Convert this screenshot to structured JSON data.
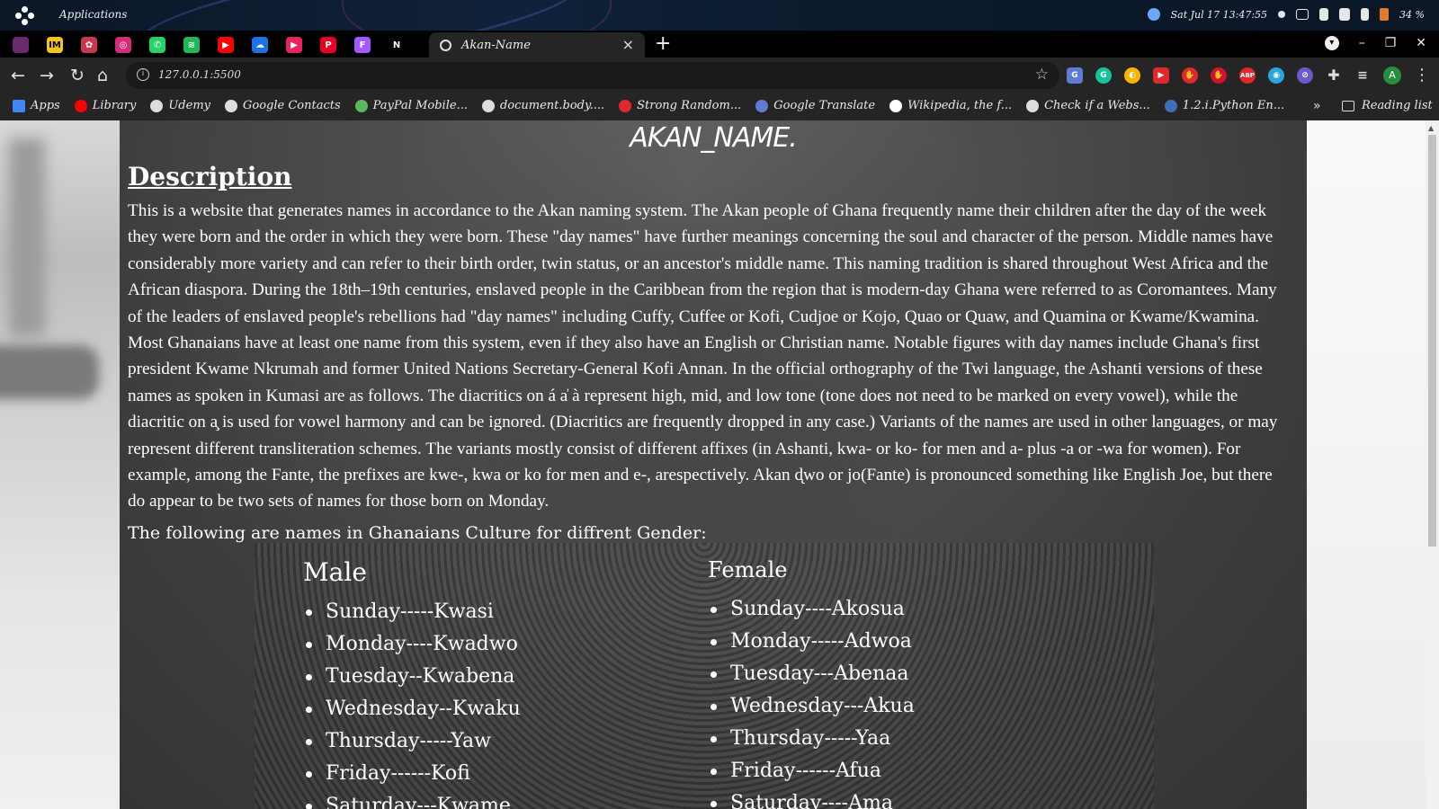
{
  "os": {
    "menu_label": "Applications",
    "clock": "Sat Jul 17   13:47:55",
    "battery": "34 %"
  },
  "browser": {
    "pinned_tabs": [
      {
        "icon": "tab-icon",
        "color": "#6b2a6b",
        "glyph": ""
      },
      {
        "icon": "imdb-icon",
        "color": "#f5c518",
        "glyph": "IM"
      },
      {
        "icon": "app-icon",
        "color": "#c8374e",
        "glyph": "✿"
      },
      {
        "icon": "instagram-icon",
        "color": "#d62976",
        "glyph": "◎"
      },
      {
        "icon": "whatsapp-icon",
        "color": "#25d366",
        "glyph": "✆"
      },
      {
        "icon": "spotify-icon",
        "color": "#1db954",
        "glyph": "≋"
      },
      {
        "icon": "youtube-icon",
        "color": "#ff0000",
        "glyph": "▶"
      },
      {
        "icon": "onedrive-icon",
        "color": "#1a73e8",
        "glyph": "☁"
      },
      {
        "icon": "music-icon",
        "color": "#e8255a",
        "glyph": "▶"
      },
      {
        "icon": "pinterest-icon",
        "color": "#e60023",
        "glyph": "P"
      },
      {
        "icon": "figma-icon",
        "color": "#a259ff",
        "glyph": "F"
      },
      {
        "icon": "netflix-icon",
        "color": "#000000",
        "glyph": "N"
      }
    ],
    "active_tab_title": "Akan-Name",
    "url": "127.0.0.1:5500",
    "bookmarks": [
      {
        "label": "Apps",
        "icon": "apps-grid-icon",
        "color": "#4285f4"
      },
      {
        "label": "Library",
        "icon": "youtube-icon",
        "color": "#ff0000"
      },
      {
        "label": "Udemy",
        "icon": "globe-icon",
        "color": "#dddddd"
      },
      {
        "label": "Google Contacts",
        "icon": "globe-icon",
        "color": "#dddddd"
      },
      {
        "label": "PayPal Mobile...",
        "icon": "t-icon",
        "color": "#5cb85c"
      },
      {
        "label": "document.body....",
        "icon": "globe-icon",
        "color": "#dddddd"
      },
      {
        "label": "Strong Random...",
        "icon": "red-icon",
        "color": "#e0282d"
      },
      {
        "label": "Google Translate",
        "icon": "translate-icon",
        "color": "#5f7bd6"
      },
      {
        "label": "Wikipedia, the f...",
        "icon": "wikipedia-icon",
        "color": "#ffffff"
      },
      {
        "label": "Check if a Webs...",
        "icon": "globe-icon",
        "color": "#dddddd"
      },
      {
        "label": "1.2.i.Python En...",
        "icon": "python-icon",
        "color": "#3f6fb5"
      }
    ],
    "bookmarks_more": "»",
    "reading_list": "Reading list"
  },
  "page": {
    "site_title": "AKAN_NAME.",
    "description_heading": "Description",
    "description_text": "This is a website that generates names in accordance to the Akan naming system. The Akan people of Ghana frequently name their children after the day of the week they were born and the order in which they were born. These \"day names\" have further meanings concerning the soul and character of the person. Middle names have considerably more variety and can refer to their birth order, twin status, or an ancestor's middle name. This naming tradition is shared throughout West Africa and the African diaspora. During the 18th–19th centuries, enslaved people in the Caribbean from the region that is modern-day Ghana were referred to as Coromantees. Many of the leaders of enslaved people's rebellions had \"day names\" including Cuffy, Cuffee or Kofi, Cudjoe or Kojo, Quao or Quaw, and Quamina or Kwame/Kwamina. Most Ghanaians have at least one name from this system, even if they also have an English or Christian name. Notable figures with day names include Ghana's first president Kwame Nkrumah and former United Nations Secretary-General Kofi Annan. In the official orthography of the Twi language, the Ashanti versions of these names as spoken in Kumasi are as follows. The diacritics on á a̍ à represent high, mid, and low tone (tone does not need to be marked on every vowel), while the diacritic on a̧ is used for vowel harmony and can be ignored. (Diacritics are frequently dropped in any case.) Variants of the names are used in other languages, or may represent different transliteration schemes. The variants mostly consist of different affixes (in Ashanti, kwa- or ko- for men and a- plus -a or -wa for women). For example, among the Fante, the prefixes are kwe-, kwa or ko for men and e-, arespectively. Akan d̨wo or jo(Fante) is pronounced something like English Joe, but there do appear to be two sets of names for those born on Monday.",
    "names_intro": "The following are names in Ghanaians Culture for diffrent Gender:",
    "male_heading": "Male",
    "female_heading": "Female",
    "male_names": [
      "Sunday-----Kwasi",
      "Monday----Kwadwo",
      "Tuesday--Kwabena",
      "Wednesday--Kwaku",
      "Thursday-----Yaw",
      "Friday------Kofi",
      "Saturday---Kwame"
    ],
    "female_names": [
      "Sunday----Akosua",
      "Monday-----Adwoa",
      "Tuesday---Abenaa",
      "Wednesday---Akua",
      "Thursday-----Yaa",
      "Friday------Afua",
      "Saturday----Ama"
    ]
  }
}
